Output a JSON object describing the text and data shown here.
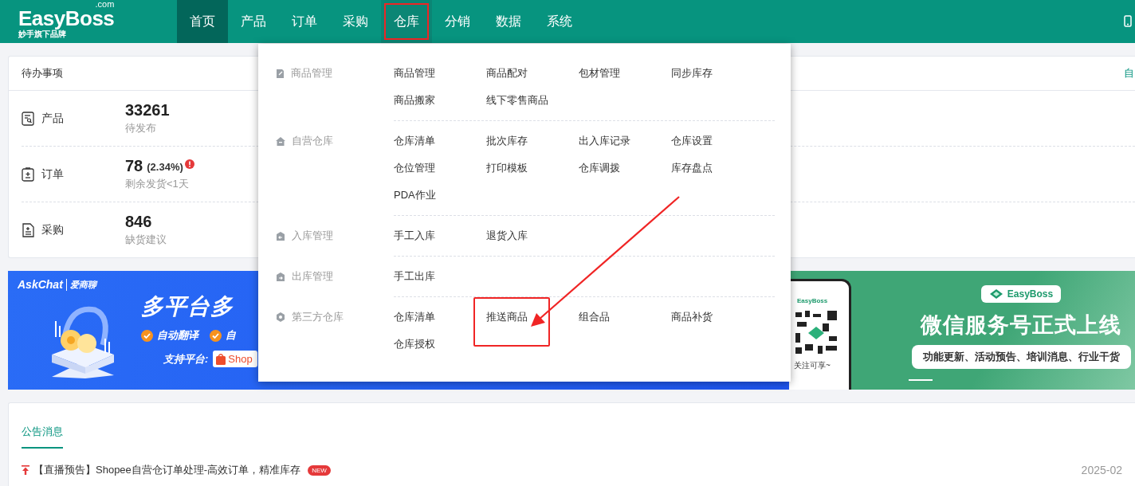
{
  "header": {
    "logo": {
      "name": "EasyBoss",
      "suffix": ".com",
      "tagline": "妙手旗下品牌"
    },
    "nav": [
      {
        "label": "首页",
        "selected": true,
        "expanded": false,
        "highlighted": false
      },
      {
        "label": "产品",
        "selected": false,
        "expanded": false,
        "highlighted": false
      },
      {
        "label": "订单",
        "selected": false,
        "expanded": false,
        "highlighted": false
      },
      {
        "label": "采购",
        "selected": false,
        "expanded": false,
        "highlighted": false
      },
      {
        "label": "仓库",
        "selected": false,
        "expanded": true,
        "highlighted": true
      },
      {
        "label": "分销",
        "selected": false,
        "expanded": false,
        "highlighted": false
      },
      {
        "label": "数据",
        "selected": false,
        "expanded": false,
        "highlighted": false
      },
      {
        "label": "系统",
        "selected": false,
        "expanded": false,
        "highlighted": false
      }
    ]
  },
  "todo": {
    "title": "待办事项",
    "link": "自",
    "rows": [
      {
        "kind": "product",
        "label": "产品",
        "value": "33261",
        "note": "待发布"
      },
      {
        "kind": "order",
        "label": "订单",
        "value": "78",
        "extra": "(2.34%)",
        "alert": true,
        "note": "剩余发货<1天"
      },
      {
        "kind": "purchase",
        "label": "采购",
        "value": "846",
        "note": "缺货建议"
      }
    ]
  },
  "banners": [
    {
      "kind": "askchat",
      "brand": "AskChat",
      "brand_cn": "爱商聊",
      "headline": "多平台多",
      "features": [
        "自动翻译",
        "自"
      ],
      "platforms_label": "支持平台:",
      "platform": "Shop"
    },
    {
      "kind": "wechat",
      "phone_brand": "EasyBoss",
      "phone_caption": "关注可享~",
      "brand": "EasyBoss",
      "headline": "微信服务号正式上线",
      "subtitle": "功能更新、活动预告、培训消息、行业干货"
    }
  ],
  "notices": {
    "tabs": [
      {
        "label": "公告消息",
        "selected": true
      }
    ],
    "items": [
      {
        "pinned": true,
        "text": "【直播预告】Shopee自营仓订单处理-高效订单，精准库存",
        "badge": "NEW",
        "date": "2025-02"
      }
    ]
  },
  "menu": {
    "groups": [
      {
        "kind": "goods",
        "label": "商品管理",
        "items": [
          {
            "label": "商品管理",
            "highlighted": false
          },
          {
            "label": "商品配对",
            "highlighted": false
          },
          {
            "label": "包材管理",
            "highlighted": false
          },
          {
            "label": "同步库存",
            "highlighted": false
          },
          {
            "label": "商品搬家",
            "highlighted": false
          },
          {
            "label": "线下零售商品",
            "highlighted": false
          }
        ]
      },
      {
        "kind": "home",
        "label": "自营仓库",
        "items": [
          {
            "label": "仓库清单",
            "highlighted": false
          },
          {
            "label": "批次库存",
            "highlighted": false
          },
          {
            "label": "出入库记录",
            "highlighted": false
          },
          {
            "label": "仓库设置",
            "highlighted": false
          },
          {
            "label": "仓位管理",
            "highlighted": false
          },
          {
            "label": "打印模板",
            "highlighted": false
          },
          {
            "label": "仓库调拨",
            "highlighted": false
          },
          {
            "label": "库存盘点",
            "highlighted": false
          },
          {
            "label": "PDA作业",
            "highlighted": false
          }
        ]
      },
      {
        "kind": "in",
        "label": "入库管理",
        "items": [
          {
            "label": "手工入库",
            "highlighted": false
          },
          {
            "label": "退货入库",
            "highlighted": false
          }
        ]
      },
      {
        "kind": "out",
        "label": "出库管理",
        "items": [
          {
            "label": "手工出库",
            "highlighted": false
          }
        ]
      },
      {
        "kind": "third",
        "label": "第三方仓库",
        "items": [
          {
            "label": "仓库清单",
            "highlighted": false
          },
          {
            "label": "推送商品",
            "highlighted": true
          },
          {
            "label": "组合品",
            "highlighted": false
          },
          {
            "label": "商品补货",
            "highlighted": false
          },
          {
            "label": "仓库授权",
            "highlighted": false
          }
        ]
      }
    ]
  }
}
